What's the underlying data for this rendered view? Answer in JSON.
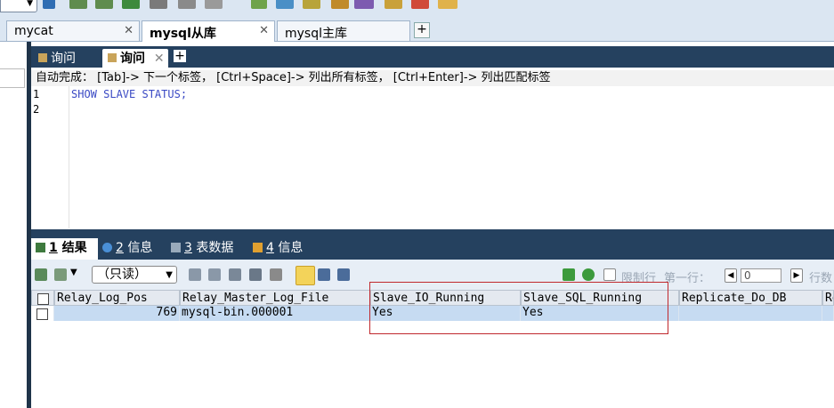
{
  "connection_tabs": [
    {
      "label": "mycat",
      "active": false
    },
    {
      "label": "mysql从库",
      "active": true
    },
    {
      "label": "mysql主库",
      "active": false
    }
  ],
  "query_tabs": [
    {
      "label": "询问",
      "active": false
    },
    {
      "label": "询问",
      "active": true
    }
  ],
  "editor": {
    "hint": "自动完成： [Tab]-> 下一个标签， [Ctrl+Space]-> 列出所有标签， [Ctrl+Enter]-> 列出匹配标签",
    "line_numbers": [
      "1",
      "2"
    ],
    "code": "SHOW SLAVE STATUS;"
  },
  "result_tabs": [
    {
      "num": "1",
      "label": "结果",
      "active": true
    },
    {
      "num": "2",
      "label": "信息",
      "active": false
    },
    {
      "num": "3",
      "label": "表数据",
      "active": false
    },
    {
      "num": "4",
      "label": "信息",
      "active": false
    }
  ],
  "result_toolbar": {
    "mode": "（只读）",
    "limit_label": "限制行",
    "first_row_label": "第一行：",
    "offset_value": "0",
    "rows_label": "行数"
  },
  "grid": {
    "columns": [
      "Relay_Log_Pos",
      "Relay_Master_Log_File",
      "Slave_IO_Running",
      "Slave_SQL_Running",
      "Replicate_Do_DB",
      "Re"
    ],
    "rows": [
      [
        "769",
        "mysql-bin.000001",
        "Yes",
        "Yes",
        "",
        ""
      ]
    ]
  },
  "colors": {
    "accent_dark": "#25415f",
    "selection": "#c6dbf2",
    "highlight_border": "#c0282d"
  }
}
